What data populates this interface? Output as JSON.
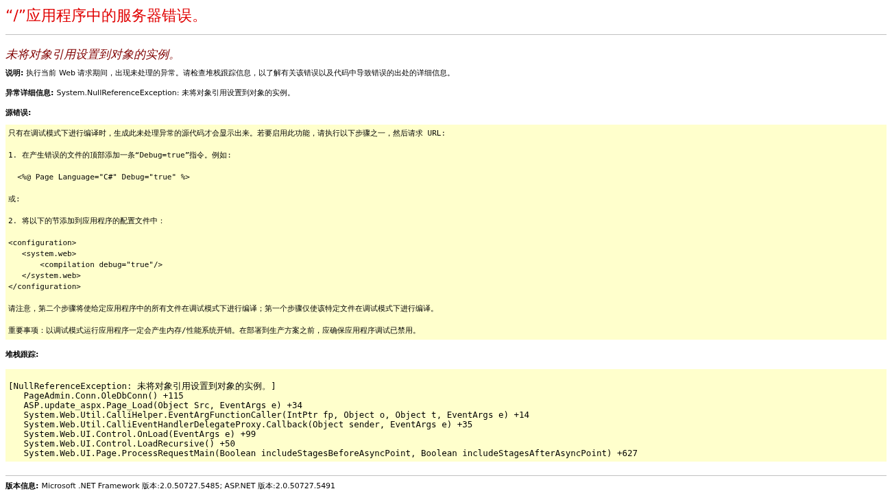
{
  "title": "“/”应用程序中的服务器错误。",
  "subtitle": "未将对象引用设置到对象的实例。",
  "details": [
    {
      "label": "说明:",
      "text": "执行当前 Web 请求期间，出现未处理的异常。请检查堆栈跟踪信息，以了解有关该错误以及代码中导致错误的出处的详细信息。"
    },
    {
      "label": "异常详细信息:",
      "text": "System.NullReferenceException: 未将对象引用设置到对象的实例。"
    }
  ],
  "source_error": {
    "label": "源错误:",
    "paragraphs": [
      [
        "只有在调试模式下进行编译时，生成此未处理异常的源代码才会显示出来。若要启用此功能，请执行以下步骤之一，然后请求 URL:"
      ],
      [
        "1. 在产生错误的文件的顶部添加一条“Debug=true”指令。例如:"
      ],
      [
        "  <%@ Page Language=\"C#\" Debug=\"true\" %>"
      ],
      [
        "或:"
      ],
      [
        "2. 将以下的节添加到应用程序的配置文件中："
      ],
      [
        "<configuration>",
        "   <system.web>",
        "       <compilation debug=\"true\"/>",
        "   </system.web>",
        "</configuration>"
      ],
      [
        "请注意，第二个步骤将使给定应用程序中的所有文件在调试模式下进行编译；第一个步骤仅使该特定文件在调试模式下进行编译。"
      ],
      [
        "重要事项：以调试模式运行应用程序一定会产生内存/性能系统开销。在部署到生产方案之前，应确保应用程序调试已禁用。"
      ]
    ]
  },
  "stack_trace": {
    "label": "堆栈跟踪:",
    "lines": [
      "[NullReferenceException: 未将对象引用设置到对象的实例。]",
      "   PageAdmin.Conn.OleDbConn() +115",
      "   ASP.update_aspx.Page_Load(Object Src, EventArgs e) +34",
      "   System.Web.Util.CalliHelper.EventArgFunctionCaller(IntPtr fp, Object o, Object t, EventArgs e) +14",
      "   System.Web.Util.CalliEventHandlerDelegateProxy.Callback(Object sender, EventArgs e) +35",
      "   System.Web.UI.Control.OnLoad(EventArgs e) +99",
      "   System.Web.UI.Control.LoadRecursive() +50",
      "   System.Web.UI.Page.ProcessRequestMain(Boolean includeStagesBeforeAsyncPoint, Boolean includeStagesAfterAsyncPoint) +627"
    ]
  },
  "version": {
    "label": "版本信息:",
    "text": "Microsoft .NET Framework 版本:2.0.50727.5485; ASP.NET 版本:2.0.50727.5491"
  }
}
